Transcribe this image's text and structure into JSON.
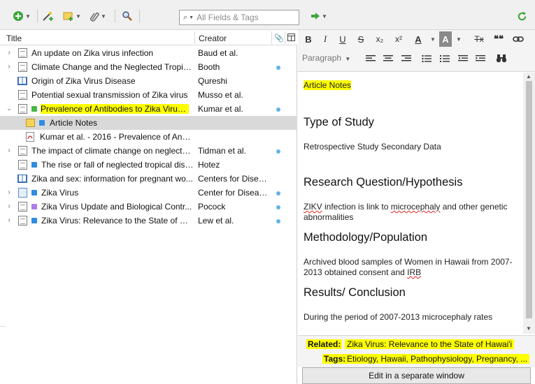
{
  "toolbar": {
    "search_placeholder": "All Fields & Tags",
    "icons": [
      "new-item-icon",
      "add-by-identifier-icon",
      "new-note-icon",
      "add-attachment-icon",
      "advanced-search-icon",
      "locate-icon",
      "sync-icon"
    ]
  },
  "columns": {
    "title": "Title",
    "creator": "Creator"
  },
  "rows": [
    {
      "title": "An update on Zika virus infection",
      "creator": "Baud et al.",
      "dot": false
    },
    {
      "title": "Climate Change and the Neglected Tropic...",
      "creator": "Booth",
      "dot": true
    },
    {
      "title": "Origin of Zika Virus Disease",
      "creator": "Qureshi",
      "dot": false
    },
    {
      "title": "Potential sexual transmission of Zika virus",
      "creator": "Musso et al.",
      "dot": false
    },
    {
      "title": "Prevalence of Antibodies to Zika Virus i...",
      "creator": "Kumar et al.",
      "dot": true
    },
    {
      "title": "Article Notes",
      "creator": "",
      "dot": false
    },
    {
      "title": "Kumar et al. - 2016 - Prevalence of Anti...",
      "creator": "",
      "dot": false
    },
    {
      "title": "The impact of climate change on neglecte...",
      "creator": "Tidman et al.",
      "dot": true
    },
    {
      "title": "The rise or fall of neglected tropical dise...",
      "creator": "Hotez",
      "dot": false
    },
    {
      "title": "Zika and sex: information for pregnant wo...",
      "creator": "Centers for Diseas...",
      "dot": false
    },
    {
      "title": "Zika Virus",
      "creator": "Center for Disease...",
      "dot": true
    },
    {
      "title": "Zika Virus Update and Biological Contr...",
      "creator": "Pocock",
      "dot": true
    },
    {
      "title": "Zika Virus: Relevance to the State of Ha...",
      "creator": "Lew et al.",
      "dot": true
    }
  ],
  "editor": {
    "toolbar_buttons": [
      "B",
      "I",
      "U",
      "S",
      "x₂",
      "x²",
      "A",
      "A",
      "Tx",
      "❝❝",
      "link"
    ],
    "paragraph_label": "Paragraph",
    "title": "Article Notes",
    "h_type": "Type of Study",
    "p_type": "Retrospective Study Secondary Data",
    "h_question": "Research Question/Hypothesis",
    "p_question_a": "ZIKV",
    "p_question_b": " infection is link to ",
    "p_question_c": "microcephaly",
    "p_question_d": " and other genetic abnormalities",
    "h_method": "Methodology/Population",
    "p_method_a": "Archived blood samples of Women in Hawaii from 2007-2013 obtained consent and ",
    "p_method_b": "IRB",
    "h_results": "Results/ Conclusion",
    "p_results": "During the period of 2007-2013 microcephaly rates"
  },
  "related": {
    "related_label": "Related:",
    "related_value": "Zika Virus: Relevance to the State of Hawai'i",
    "tags_label": "Tags:",
    "tags_value": "Etiology, Hawaii, Pathophysiology, Pregnancy, ...",
    "edit_button": "Edit in a separate window"
  },
  "colors": {
    "highlight": "#fdff00",
    "selected_row": "#d9d9d9",
    "blue_square": "#2e8de0",
    "green_square": "#46b843",
    "purple_square": "#b07ce6"
  }
}
